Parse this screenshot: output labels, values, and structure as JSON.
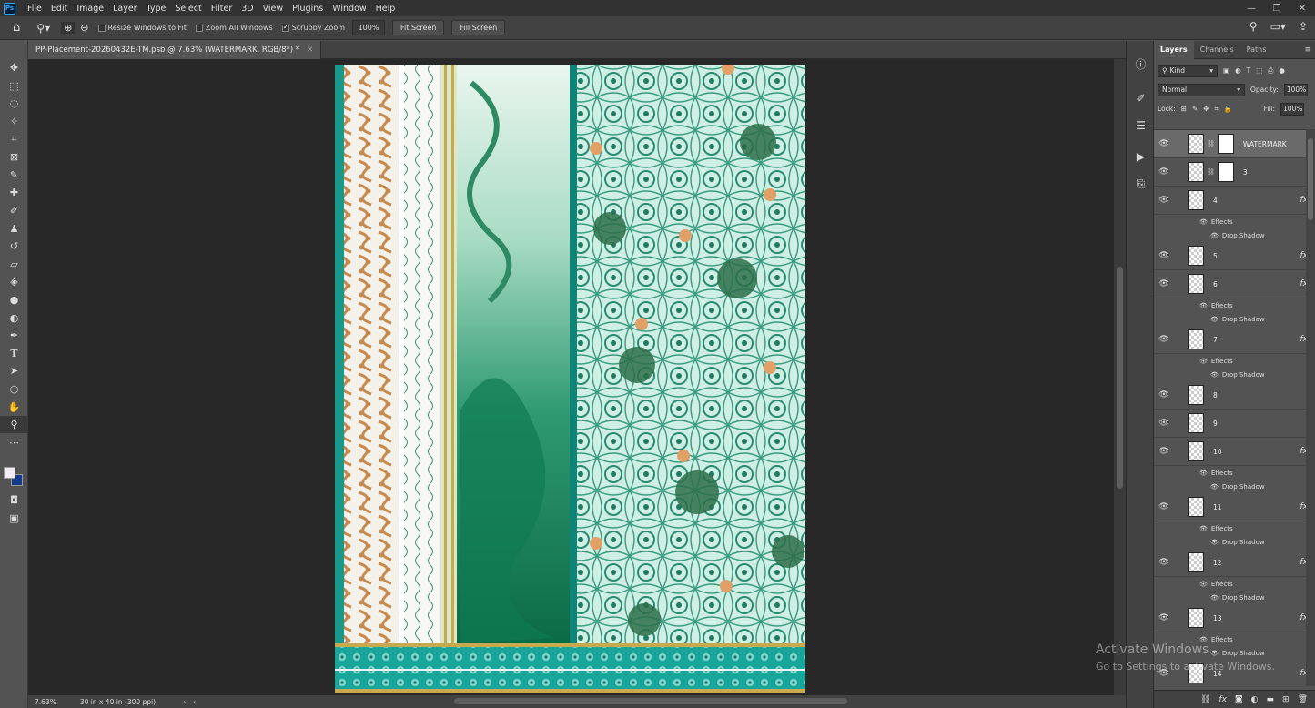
{
  "menu": [
    "File",
    "Edit",
    "Image",
    "Layer",
    "Type",
    "Select",
    "Filter",
    "3D",
    "View",
    "Plugins",
    "Window",
    "Help"
  ],
  "options": {
    "resize_windows": "Resize Windows to Fit",
    "zoom_all": "Zoom All Windows",
    "scrubby_zoom": "Scrubby Zoom",
    "zoom_value": "100%",
    "fit_screen": "Fit Screen",
    "fill_screen": "Fill Screen"
  },
  "document": {
    "tab_title": "PP-Placement-20260432E-TM.psb @ 7.63% (WATERMARK, RGB/8*) *",
    "zoom": "7.63%",
    "doc_info": "30 in x 40 in (300 ppi)"
  },
  "colors": {
    "foreground": "#f3ecf2",
    "background": "#143b8a",
    "accent": "#31a8ff"
  },
  "panel": {
    "tabs": [
      "Layers",
      "Channels",
      "Paths"
    ],
    "kind": "Kind",
    "blend_mode": "Normal",
    "opacity_label": "Opacity:",
    "opacity_value": "100%",
    "lock_label": "Lock:",
    "fill_label": "Fill:",
    "fill_value": "100%"
  },
  "layers": [
    {
      "name": "WATERMARK",
      "mask": true,
      "fx": false
    },
    {
      "name": "3",
      "mask": true,
      "fx": false
    },
    {
      "name": "4",
      "fx": true,
      "effects": true
    },
    {
      "name": "5",
      "fx": true,
      "effects": false
    },
    {
      "name": "6",
      "fx": true,
      "effects": true
    },
    {
      "name": "7",
      "fx": true,
      "effects": true
    },
    {
      "name": "8",
      "fx": false,
      "effects": false
    },
    {
      "name": "9",
      "fx": false,
      "effects": false
    },
    {
      "name": "10",
      "fx": true,
      "effects": true
    },
    {
      "name": "11",
      "fx": true,
      "effects": true
    },
    {
      "name": "12",
      "fx": true,
      "effects": true
    },
    {
      "name": "13",
      "fx": true,
      "effects": true
    },
    {
      "name": "14",
      "fx": true,
      "effects": true
    }
  ],
  "effects_label": "Effects",
  "drop_shadow_label": "Drop Shadow",
  "windows_watermark": {
    "line1": "Activate Windows",
    "line2": "Go to Settings to activate Windows."
  }
}
